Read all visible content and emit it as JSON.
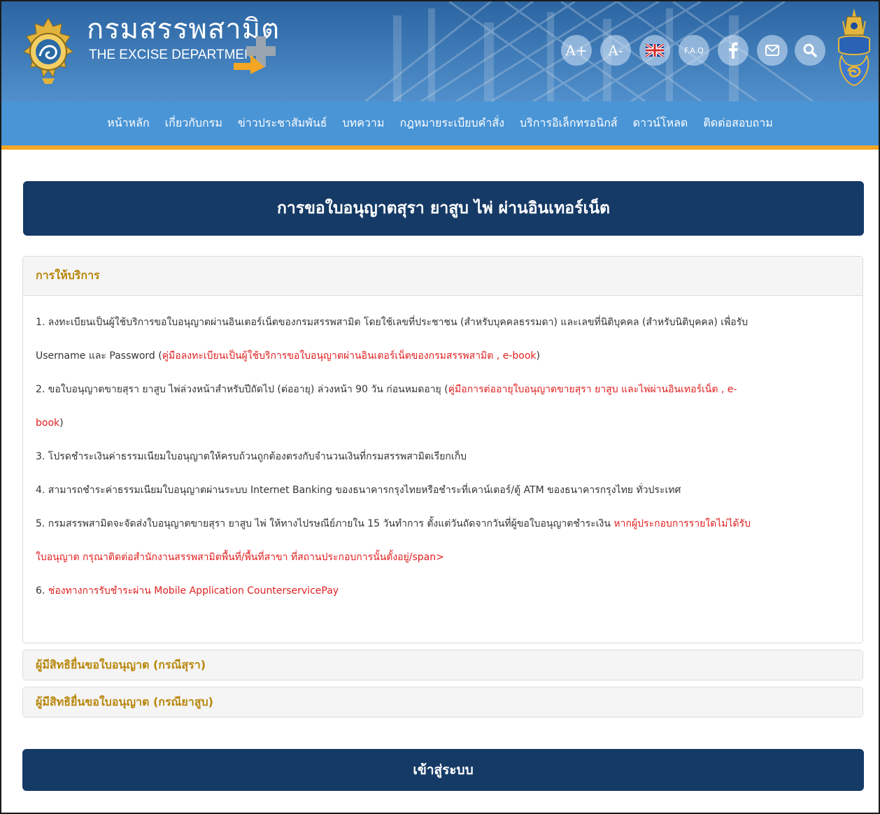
{
  "header": {
    "logo_th": "กรมสรรพสามิต",
    "logo_en": "THE EXCISE DEPARTMENT",
    "tools": {
      "font_increase": "A+",
      "font_decrease": "A-",
      "faq": "F.A.Q"
    }
  },
  "nav": {
    "items": [
      "หน้าหลัก",
      "เกี่ยวกับกรม",
      "ข่าวประชาสัมพันธ์",
      "บทความ",
      "กฎหมายระเบียบคำสั่ง",
      "บริการอิเล็กทรอนิกส์",
      "ดาวน์โหลด",
      "ติดต่อสอบถาม"
    ]
  },
  "page": {
    "title": "การขอใบอนุญาตสุรา ยาสูบ ไพ่ ผ่านอินเทอร์เน็ต"
  },
  "service": {
    "heading": "การให้บริการ",
    "items": [
      {
        "text": "1. ลงทะเบียนเป็นผู้ใช้บริการขอใบอนุญาตผ่านอินเตอร์เน็ตของกรมสรรพสามิต โดยใช้เลขที่ประชาชน (สำหรับบุคคลธรรมดา) และเลขที่นิติบุคคล (สำหรับนิติบุคคล) เพื่อรับ"
      },
      {
        "text": "Username และ Password (",
        "link": "คู่มือลงทะเบียนเป็นผู้ใช้บริการขอใบอนุญาตผ่านอินเตอร์เน็ตของกรมสรรพสามิต , e-book",
        "after": ")"
      },
      {
        "text": "2. ขอใบอนุญาตขายสุรา ยาสูบ ไพ่ล่วงหน้าสำหรับปีถัดไป (ต่ออายุ) ล่วงหน้า 90 วัน ก่อนหมดอายุ (",
        "link": "คู่มือการต่ออายุใบอนุญาตขายสุรา ยาสูบ และไพ่ผ่านอินเทอร์เน็ต , e-"
      },
      {
        "text": "",
        "link": "book",
        "after": ")"
      },
      {
        "text": "3. โปรดชำระเงินค่าธรรมเนียมใบอนุญาตให้ครบถ้วนถูกต้องตรงกับจำนวนเงินที่กรมสรรพสามิตเรียกเก็บ"
      },
      {
        "text": "4. สามารถชำระค่าธรรมเนียมใบอนุญาตผ่านระบบ Internet Banking ของธนาคารกรุงไทยหรือชำระที่เคาน์เตอร์/ตู้ ATM ของธนาคารกรุงไทย ทั่วประเทศ"
      },
      {
        "text": "5. กรมสรรพสามิตจะจัดส่งใบอนุญาตขายสุรา ยาสูบ ไพ่ ให้ทางไปรษณีย์ภายใน 15 วันทำการ ตั้งแต่วันถัดจากวันที่ผู้ขอใบอนุญาตชำระเงิน ",
        "link": "หากผู้ประกอบการรายใดไม่ได้รับ"
      },
      {
        "text": "",
        "link": "ใบอนุญาต กรุณาติดต่อสำนักงานสรรพสามิตพื้นที่/พื้นที่สาขา ที่สถานประกอบการนั้นตั้งอยู่/span>"
      },
      {
        "text": "6. ",
        "link": "ช่องทางการรับชำระผ่าน Mobile Application CounterservicePay"
      }
    ]
  },
  "accordion": {
    "liquor": "ผู้มีสิทธิยื่นขอใบอนุญาต (กรณีสุรา)",
    "tobacco": "ผู้มีสิทธิยื่นขอใบอนุญาต (กรณียาสูบ)"
  },
  "login": {
    "label": "เข้าสู่ระบบ"
  },
  "colors": {
    "navy": "#153a66",
    "nav_blue": "#4a95d6",
    "accent_orange": "#f5a623",
    "heading_gold": "#b8860b",
    "link_red": "#e02020"
  },
  "icons": [
    "excise-emblem-icon",
    "plus-arrow-icon",
    "uk-flag-icon",
    "facebook-icon",
    "mail-icon",
    "search-icon",
    "royal-emblem-icon"
  ]
}
